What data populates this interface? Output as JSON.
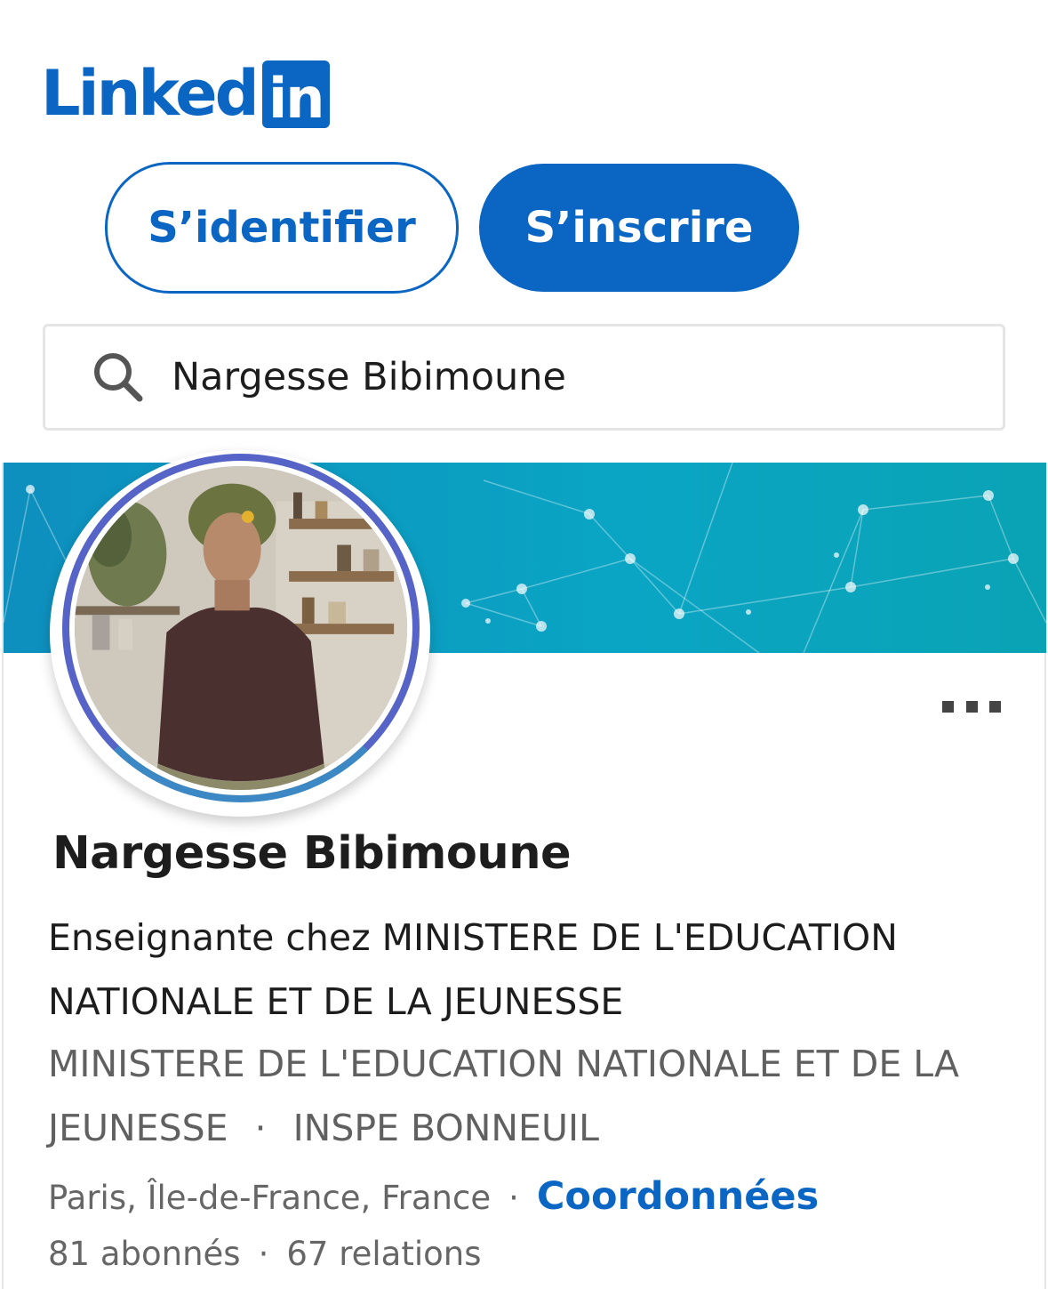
{
  "brand": {
    "logo_word": "Linked",
    "logo_box": "in",
    "color": "#0a66c2"
  },
  "auth": {
    "login_label": "S’identifier",
    "join_label": "S’inscrire"
  },
  "search": {
    "value": "Nargesse Bibimoune",
    "icon": "search-icon"
  },
  "profile": {
    "name": "Nargesse Bibimoune",
    "headline": "Enseignante chez MINISTERE DE L'EDUCATION NATIONALE ET DE LA JEUNESSE",
    "company": "MINISTERE DE L'EDUCATION NATIONALE ET DE LA JEUNESSE",
    "separator": "·",
    "school": "INSPE BONNEUIL",
    "location": "Paris, Île-de-France, France",
    "contact_label": "Coordonnées",
    "followers": "81 abonnés",
    "connections": "67 relations",
    "more_icon": "more-options-icon"
  }
}
